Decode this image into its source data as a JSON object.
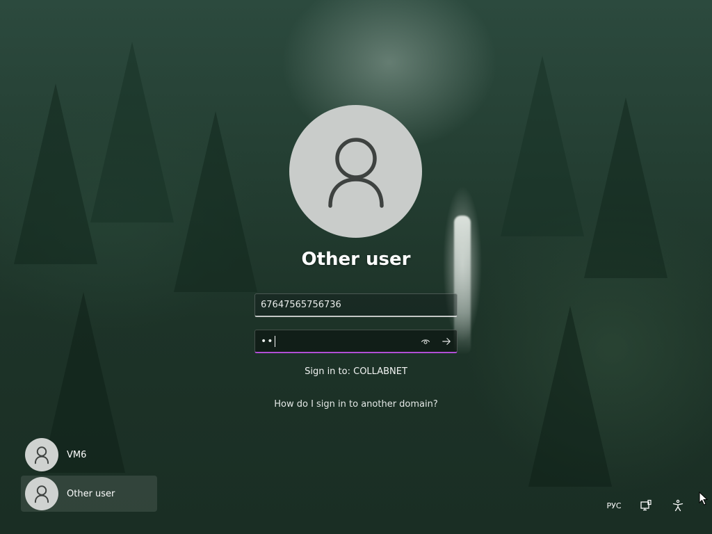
{
  "login": {
    "title": "Other user",
    "username_value": "67647565756736",
    "password_mask": "••",
    "sign_in_to": "Sign in to: COLLABNET",
    "other_domain_link": "How do I sign in to another domain?"
  },
  "icons": {
    "avatar": "user-silhouette-icon",
    "reveal_password": "eye-icon",
    "submit": "arrow-right-icon",
    "network": "network-icon",
    "accessibility": "accessibility-icon",
    "cursor": "mouse-pointer-icon"
  },
  "users": [
    {
      "name": "VM6",
      "selected": false
    },
    {
      "name": "Other user",
      "selected": true
    }
  ],
  "tray": {
    "language": "РУС"
  },
  "colors": {
    "password_focus_underline": "#b14fd6",
    "avatar_background": "#c9ccca"
  }
}
